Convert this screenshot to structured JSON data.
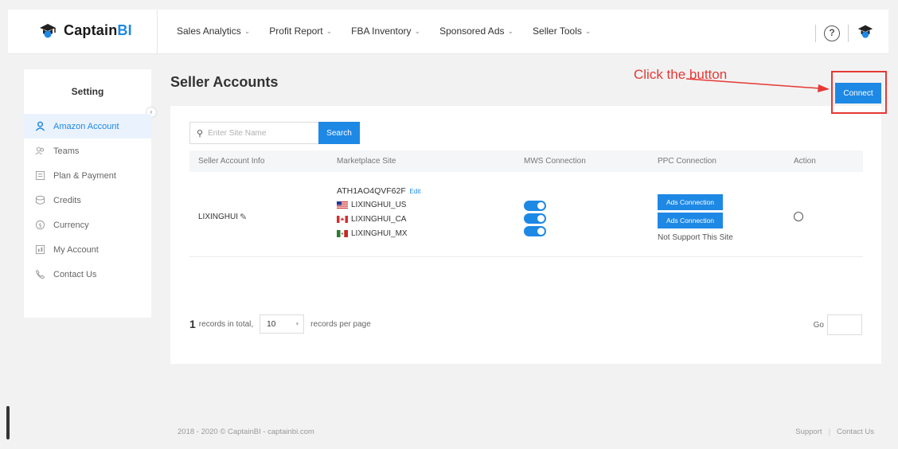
{
  "brand": {
    "name_main": "Captain",
    "name_accent": "BI"
  },
  "nav": {
    "items": [
      {
        "label": "Sales Analytics"
      },
      {
        "label": "Profit Report"
      },
      {
        "label": "FBA Inventory"
      },
      {
        "label": "Sponsored Ads"
      },
      {
        "label": "Seller Tools"
      }
    ],
    "help_glyph": "?"
  },
  "sidebar": {
    "title": "Setting",
    "collapse_glyph": "‹",
    "items": [
      {
        "label": "Amazon Account",
        "icon": "person-icon",
        "active": true
      },
      {
        "label": "Teams",
        "icon": "team-icon",
        "active": false
      },
      {
        "label": "Plan & Payment",
        "icon": "plan-icon",
        "active": false
      },
      {
        "label": "Credits",
        "icon": "credits-icon",
        "active": false
      },
      {
        "label": "Currency",
        "icon": "currency-icon",
        "active": false
      },
      {
        "label": "My Account",
        "icon": "account-icon",
        "active": false
      },
      {
        "label": "Contact Us",
        "icon": "phone-icon",
        "active": false
      }
    ]
  },
  "main": {
    "title": "Seller Accounts",
    "search": {
      "placeholder": "Enter Site Name",
      "button_label": "Search",
      "search_glyph": "⚲"
    },
    "table": {
      "headers": [
        "Seller Account Info",
        "Marketplace Site",
        "MWS Connection",
        "PPC Connection",
        "Action"
      ],
      "rows": [
        {
          "account_name": "LIXINGHUI",
          "edit_glyph": "✎",
          "account_id": "ATH1AO4QVF62F",
          "edit_label": "Edit",
          "sites": [
            {
              "name": "LIXINGHUI_US",
              "flag": "us-flag"
            },
            {
              "name": "LIXINGHUI_CA",
              "flag": "ca-flag"
            },
            {
              "name": "LIXINGHUI_MX",
              "flag": "mx-flag"
            }
          ],
          "ppc_buttons": [
            "Ads Connection",
            "Ads Connection"
          ],
          "ppc_note": "Not Support This Site"
        }
      ]
    },
    "pagination": {
      "total": "1",
      "total_suffix": "records in total,",
      "page_size": "10",
      "page_size_suffix": "records per page",
      "goto_label": "Go",
      "chevron_glyph": "▾"
    }
  },
  "annotation": {
    "text": "Click the button",
    "connect_label": "Connect"
  },
  "footer": {
    "copyright": "2018 - 2020 © CaptainBI - captainbi.com",
    "links": [
      "Support",
      "Contact Us"
    ],
    "separator": "|"
  },
  "colors": {
    "accent": "#1e88e5",
    "annotation": "#e53935"
  }
}
